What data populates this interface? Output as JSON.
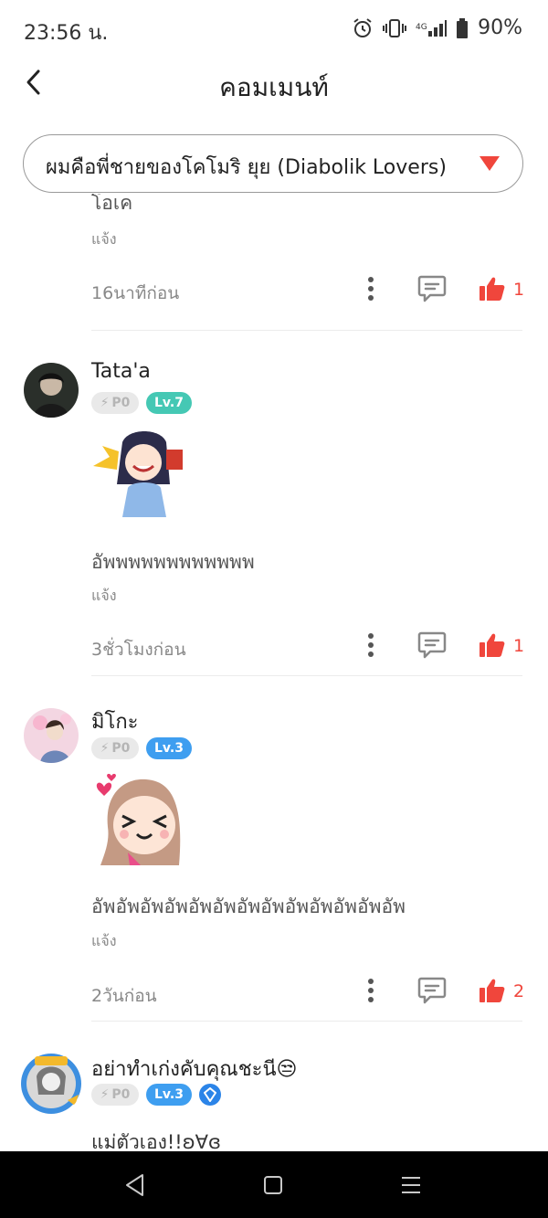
{
  "status": {
    "time": "23:56 น.",
    "battery": "90%"
  },
  "header": {
    "title": "คอมเมนท์"
  },
  "selector": {
    "label": "ผมคือพี่ชายของโคโมริ ยุย (Diabolik Lovers)"
  },
  "comments": [
    {
      "text": "โอเค",
      "report": "แจ้ง",
      "time": "16นาทีก่อน",
      "likes": "1"
    },
    {
      "username": "Tata'a",
      "points": "P0",
      "level": "Lv.7",
      "level_color": "#45c8b4",
      "text": "อัพพพพพพพพพพพพ",
      "report": "แจ้ง",
      "time": "3ชั่วโมงก่อน",
      "likes": "1"
    },
    {
      "username": "มิโกะ",
      "points": "P0",
      "level": "Lv.3",
      "level_color": "#3e9ef0",
      "text": "อัพอัพอัพอัพอัพอัพอัพอัพอัพอัพอัพอัพอัพ",
      "report": "แจ้ง",
      "time": "2วันก่อน",
      "likes": "2"
    },
    {
      "username": "อย่าทำเก่งคับคุณชะนี😒",
      "points": "P0",
      "level": "Lv.3",
      "level_color": "#3e9ef0",
      "text": "แม่ตัวเอง!!ʚ∀ɞ"
    }
  ],
  "colors": {
    "accent": "#f0463c"
  }
}
